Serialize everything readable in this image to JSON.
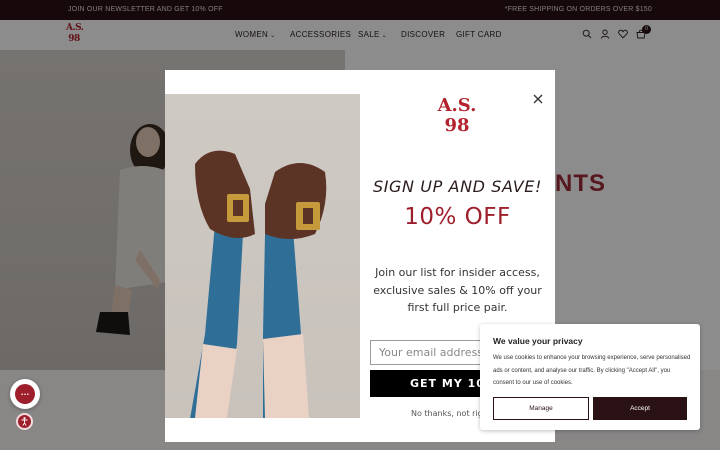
{
  "announcement": {
    "left": "JOIN OUR NEWSLETTER AND GET 10% OFF",
    "right": "*FREE SHIPPING ON ORDERS OVER $150"
  },
  "header": {
    "logo_line1": "A.S.",
    "logo_line2": "98",
    "nav": [
      {
        "label": "WOMEN",
        "has_dropdown": true
      },
      {
        "label": "ACCESSORIES",
        "has_dropdown": false
      },
      {
        "label": "SALE",
        "has_dropdown": true
      },
      {
        "label": "DISCOVER",
        "has_dropdown": false
      },
      {
        "label": "GIFT CARD",
        "has_dropdown": false
      }
    ],
    "icons": [
      "search-icon",
      "account-icon",
      "wishlist-icon",
      "cart-icon"
    ],
    "cart_count": "0"
  },
  "hero": {
    "partial_heading": "NTS"
  },
  "modal": {
    "logo_line1": "A.S.",
    "logo_line2": "98",
    "heading": "SIGN UP AND SAVE!",
    "discount": "10% OFF",
    "body_line1": "Join our list for insider access,",
    "body_line2": "exclusive sales & 10% off your",
    "body_line3": "first full price pair.",
    "email_placeholder": "Your email address",
    "submit_label": "GET MY 10% OFF",
    "decline_label": "No thanks, not right now"
  },
  "cookie": {
    "title": "We value your privacy",
    "text": "We use cookies to enhance your browsing experience, serve personalised ads or content, and analyse our traffic. By clicking \"Accept All\", you consent to our use of cookies.",
    "manage_label": "Manage",
    "accept_label": "Accept"
  },
  "colors": {
    "brand_red": "#b2232d",
    "dark_maroon": "#2a1214",
    "discount_red": "#9e1f2c"
  }
}
